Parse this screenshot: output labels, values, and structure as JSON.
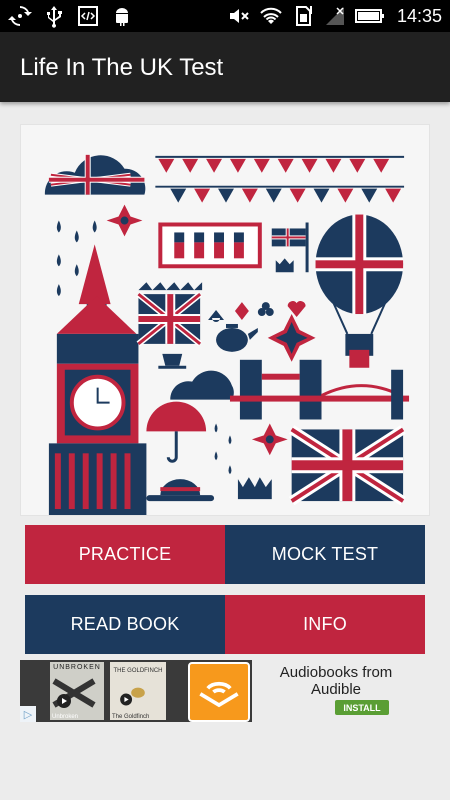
{
  "status_bar": {
    "time": "14:35",
    "icons_left": [
      "sync-icon",
      "usb-icon",
      "code-icon",
      "android-icon"
    ],
    "icons_right": [
      "mute-icon",
      "wifi-icon",
      "sim-icon",
      "signal-icon",
      "battery-icon"
    ]
  },
  "app_bar": {
    "title": "Life In The UK Test"
  },
  "buttons": {
    "practice": "PRACTICE",
    "mock_test": "MOCK TEST",
    "read_book": "READ BOOK",
    "info": "INFO"
  },
  "ad": {
    "title": "Audiobooks from Audible",
    "install": "INSTALL",
    "cover_1_title": "UNBROKEN",
    "cover_1_caption": "Unbroken",
    "cover_2_title": "THE GOLDFINCH",
    "cover_2_caption": "The Goldfinch",
    "badge": "▷"
  },
  "colors": {
    "red": "#c0253f",
    "navy": "#1c3a5e",
    "app_bar": "#212121",
    "background": "#ececec"
  }
}
